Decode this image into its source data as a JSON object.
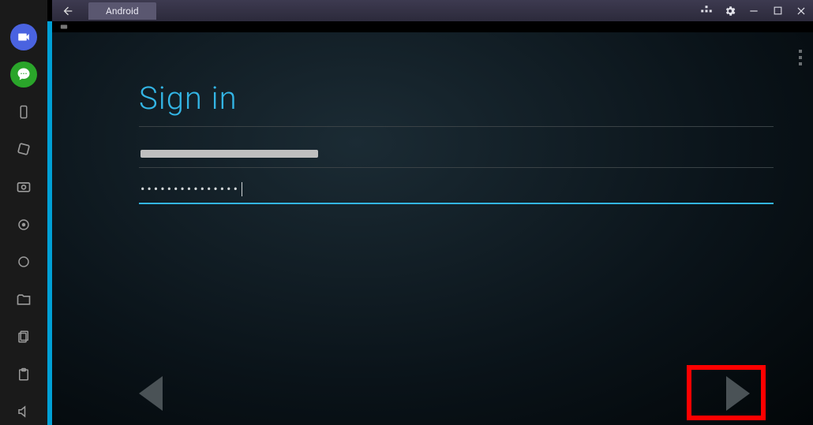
{
  "titlebar": {
    "back_label": "Back",
    "tab_label": "Android"
  },
  "rail": {
    "icons": [
      "camera-icon",
      "chat-icon",
      "phone-icon",
      "rotate-icon",
      "screenshot-icon",
      "location-icon",
      "apk-icon",
      "folder-icon",
      "copy-icon",
      "paste-icon",
      "volume-icon"
    ]
  },
  "signin": {
    "title": "Sign in",
    "email_value": "",
    "password_mask": "•••••••••••••••"
  },
  "window_controls": {
    "apps": "apps",
    "settings": "settings",
    "minimize": "minimize",
    "maximize": "maximize",
    "close": "close"
  }
}
